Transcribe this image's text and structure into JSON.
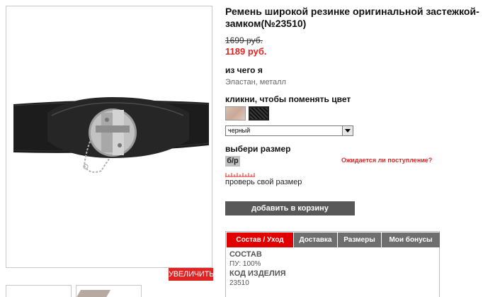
{
  "product": {
    "title": "Ремень широкой резинке оригинальной застежкой-замком(№23510)",
    "old_price": "1699 руб.",
    "new_price": "1189 руб."
  },
  "gallery": {
    "zoom_label": "УВЕЛИЧИТЬ"
  },
  "material": {
    "label": "из чего я",
    "value": "Эластан, металл"
  },
  "color": {
    "label": "кликни, чтобы поменять цвет",
    "selected": "черный",
    "swatches": [
      "beige",
      "black"
    ]
  },
  "size": {
    "label": "выбери размер",
    "option": "б/р",
    "await_link": "Ожидается ли поступление?",
    "check_link": "проверь свой размер"
  },
  "cart": {
    "button_label": "добавить в корзину"
  },
  "tabs": {
    "items": [
      {
        "label": "Состав / Уход",
        "active": true
      },
      {
        "label": "Доставка",
        "active": false
      },
      {
        "label": "Размеры",
        "active": false
      },
      {
        "label": "Мои бонусы",
        "active": false
      }
    ],
    "content": {
      "composition_heading": "СОСТАВ",
      "composition_value": "ПУ: 100%",
      "code_heading": "КОД ИЗДЕЛИЯ",
      "code_value": "23510"
    }
  },
  "colors": {
    "accent_red": "#e02424",
    "tab_active": "#e00000",
    "tab_inactive": "#6e6e6e",
    "button_dark": "#585858"
  }
}
